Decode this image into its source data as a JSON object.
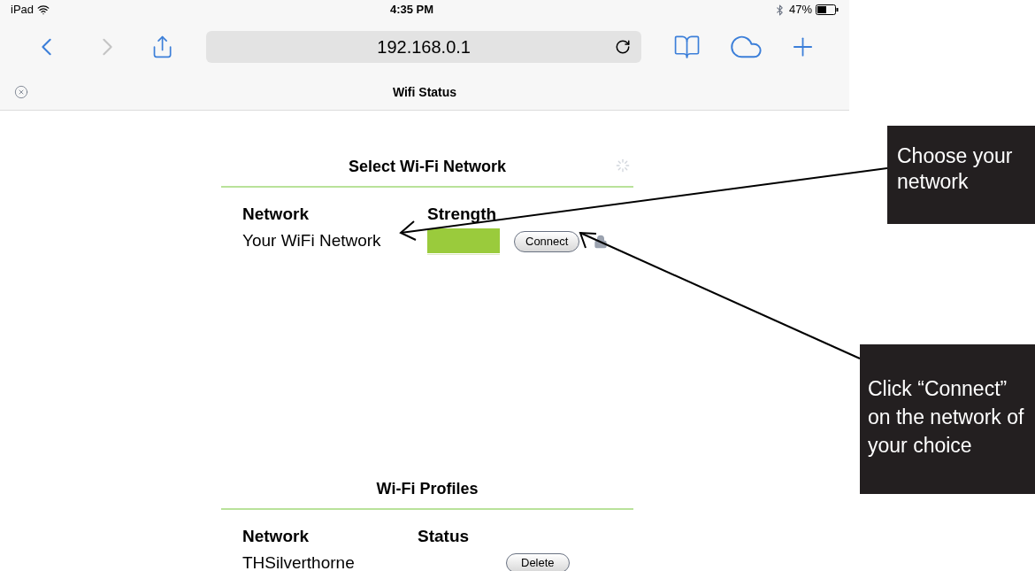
{
  "status_bar": {
    "device": "iPad",
    "time": "4:35 PM",
    "battery": "47%"
  },
  "browser": {
    "address": "192.168.0.1",
    "tab_title": "Wifi Status"
  },
  "select_section": {
    "title": "Select Wi-Fi Network",
    "columns": [
      "Network",
      "Strength"
    ],
    "rows": [
      {
        "network": "Your WiFi Network",
        "level": 1,
        "button": "Connect",
        "locked": true
      }
    ]
  },
  "profiles_section": {
    "title": "Wi-Fi Profiles",
    "columns": [
      "Network",
      "Status"
    ],
    "rows": [
      {
        "network": "THSilverthorne",
        "button": "Delete"
      }
    ]
  },
  "callouts": [
    {
      "text": "Choose your network"
    },
    {
      "text": "Click “Connect” on the network of your choice"
    }
  ]
}
